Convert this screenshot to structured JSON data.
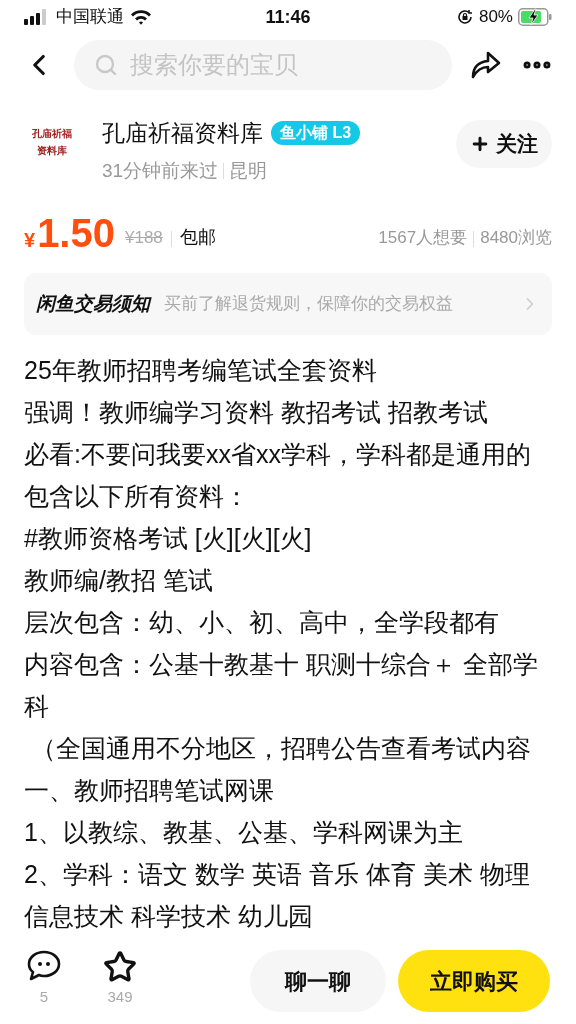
{
  "status_bar": {
    "carrier": "中国联通",
    "time": "11:46",
    "battery": "80%",
    "charging": true
  },
  "search": {
    "placeholder": "搜索你要的宝贝"
  },
  "seller": {
    "avatar_lines": [
      "孔庙祈福",
      "资料库"
    ],
    "name": "孔庙祈福资料库",
    "badge": "鱼小铺 L3",
    "last_seen": "31分钟前来过",
    "city": "昆明",
    "follow_label": "关注"
  },
  "price": {
    "currency": "¥",
    "amount": "1.50",
    "original": "¥188",
    "shipping": "包邮",
    "wants": "1567人想要",
    "views": "8480浏览"
  },
  "notice": {
    "title": "闲鱼交易须知",
    "text": "买前了解退货规则，保障你的交易权益"
  },
  "description": [
    "25年教师招聘考编笔试全套资料",
    "强调！教师编学习资料 教招考试 招教考试",
    "必看:不要问我要xx省xx学科，学科都是通用的",
    "包含以下所有资料：",
    "#教师资格考试 [火][火][火]",
    "教师编/教招 笔试",
    "层次包含：幼、小、初、高中，全学段都有",
    "内容包含：公基十教基十 职测十综合＋ 全部学科",
    " （全国通用不分地区，招聘公告查看考试内容",
    "一、教师招聘笔试网课",
    "1、以教综、教基、公基、学科网课为主",
    "2、学科：语文 数学 英语 音乐 体育 美术 物理信息技术 科学技术 幼儿园"
  ],
  "bottom_bar": {
    "comments": "5",
    "favorites": "349",
    "chat_label": "聊一聊",
    "buy_label": "立即购买"
  }
}
